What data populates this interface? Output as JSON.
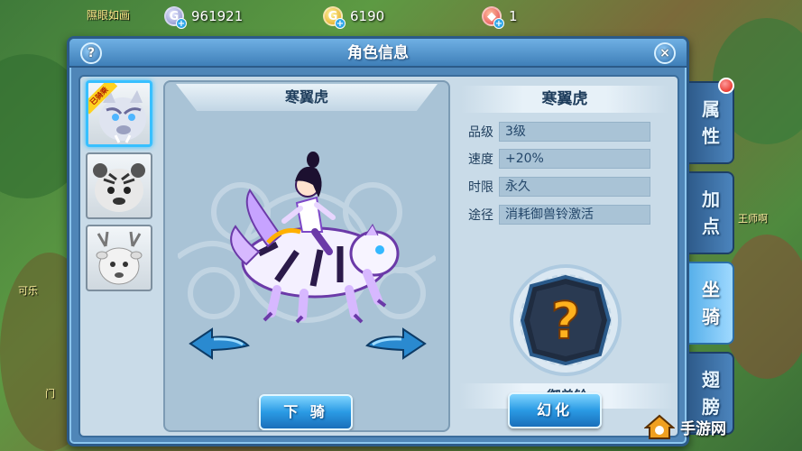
{
  "top_bar": {
    "player_name": "隰眼如画",
    "silver": {
      "icon": "silver-coin-icon",
      "value": "961921"
    },
    "gold": {
      "icon": "gold-coin-icon",
      "value": "6190"
    },
    "gem": {
      "icon": "gem-icon",
      "value": "1"
    }
  },
  "panel": {
    "title": "角色信息",
    "help_label": "?",
    "close_label": "×"
  },
  "mounts": [
    {
      "name": "寒翼虎",
      "badge": "已骑乘",
      "active": true
    },
    {
      "name": "mount-2",
      "active": false
    },
    {
      "name": "mount-3",
      "active": false
    }
  ],
  "stage": {
    "mount_name": "寒翼虎",
    "dismount_label": "下 骑"
  },
  "info": {
    "title": "寒翼虎",
    "rows": [
      {
        "key": "品级",
        "value": "3级"
      },
      {
        "key": "速度",
        "value": "+20%"
      },
      {
        "key": "时限",
        "value": "永久"
      },
      {
        "key": "途径",
        "value": "消耗御兽铃激活"
      }
    ],
    "slot_label": "御兽铃",
    "slot_icon": "question-mark-icon",
    "transform_label": "幻化"
  },
  "tabs": [
    {
      "label": "属性",
      "active": false
    },
    {
      "label": "加点",
      "active": false
    },
    {
      "label": "坐骑",
      "active": true
    },
    {
      "label": "翅膀",
      "active": false
    }
  ],
  "background_npc_labels": [
    "王师啊",
    "可乐",
    "门"
  ],
  "watermark": {
    "text": "手游网"
  },
  "colors": {
    "panel_blue": "#4f86b8",
    "inner_bg": "#c9dbe8",
    "button_blue": "#2a9ae4",
    "active_tab": "#57b0ea",
    "notify_red": "#e0180c"
  }
}
